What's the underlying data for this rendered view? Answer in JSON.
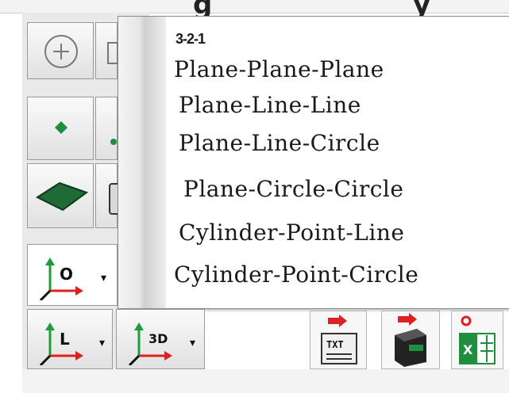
{
  "window": {
    "partial_title_glyphs": [
      "g",
      "y"
    ]
  },
  "menu": {
    "items": [
      {
        "label": "3-2-1",
        "style": "small"
      },
      {
        "label": "Plane-Plane-Plane",
        "style": "normal"
      },
      {
        "label": "Plane-Line-Line",
        "style": "normal"
      },
      {
        "label": "Plane-Line-Circle",
        "style": "normal"
      },
      {
        "label": "Plane-Circle-Circle",
        "style": "normal"
      },
      {
        "label": "Cylinder-Point-Line",
        "style": "normal"
      },
      {
        "label": "Cylinder-Point-Circle",
        "style": "normal"
      }
    ]
  },
  "toolbar": {
    "coord_origin_label": "O",
    "coord_line_label": "L",
    "coord_3d_label": "3D",
    "export_txt_label": "TXT",
    "export_excel_label": "X"
  },
  "colors": {
    "axis_green": "#1a9e3a",
    "axis_red": "#e02020",
    "plane_green": "#1f6a35",
    "excel_green": "#1f8f3f",
    "arrow_red": "#e02020"
  }
}
